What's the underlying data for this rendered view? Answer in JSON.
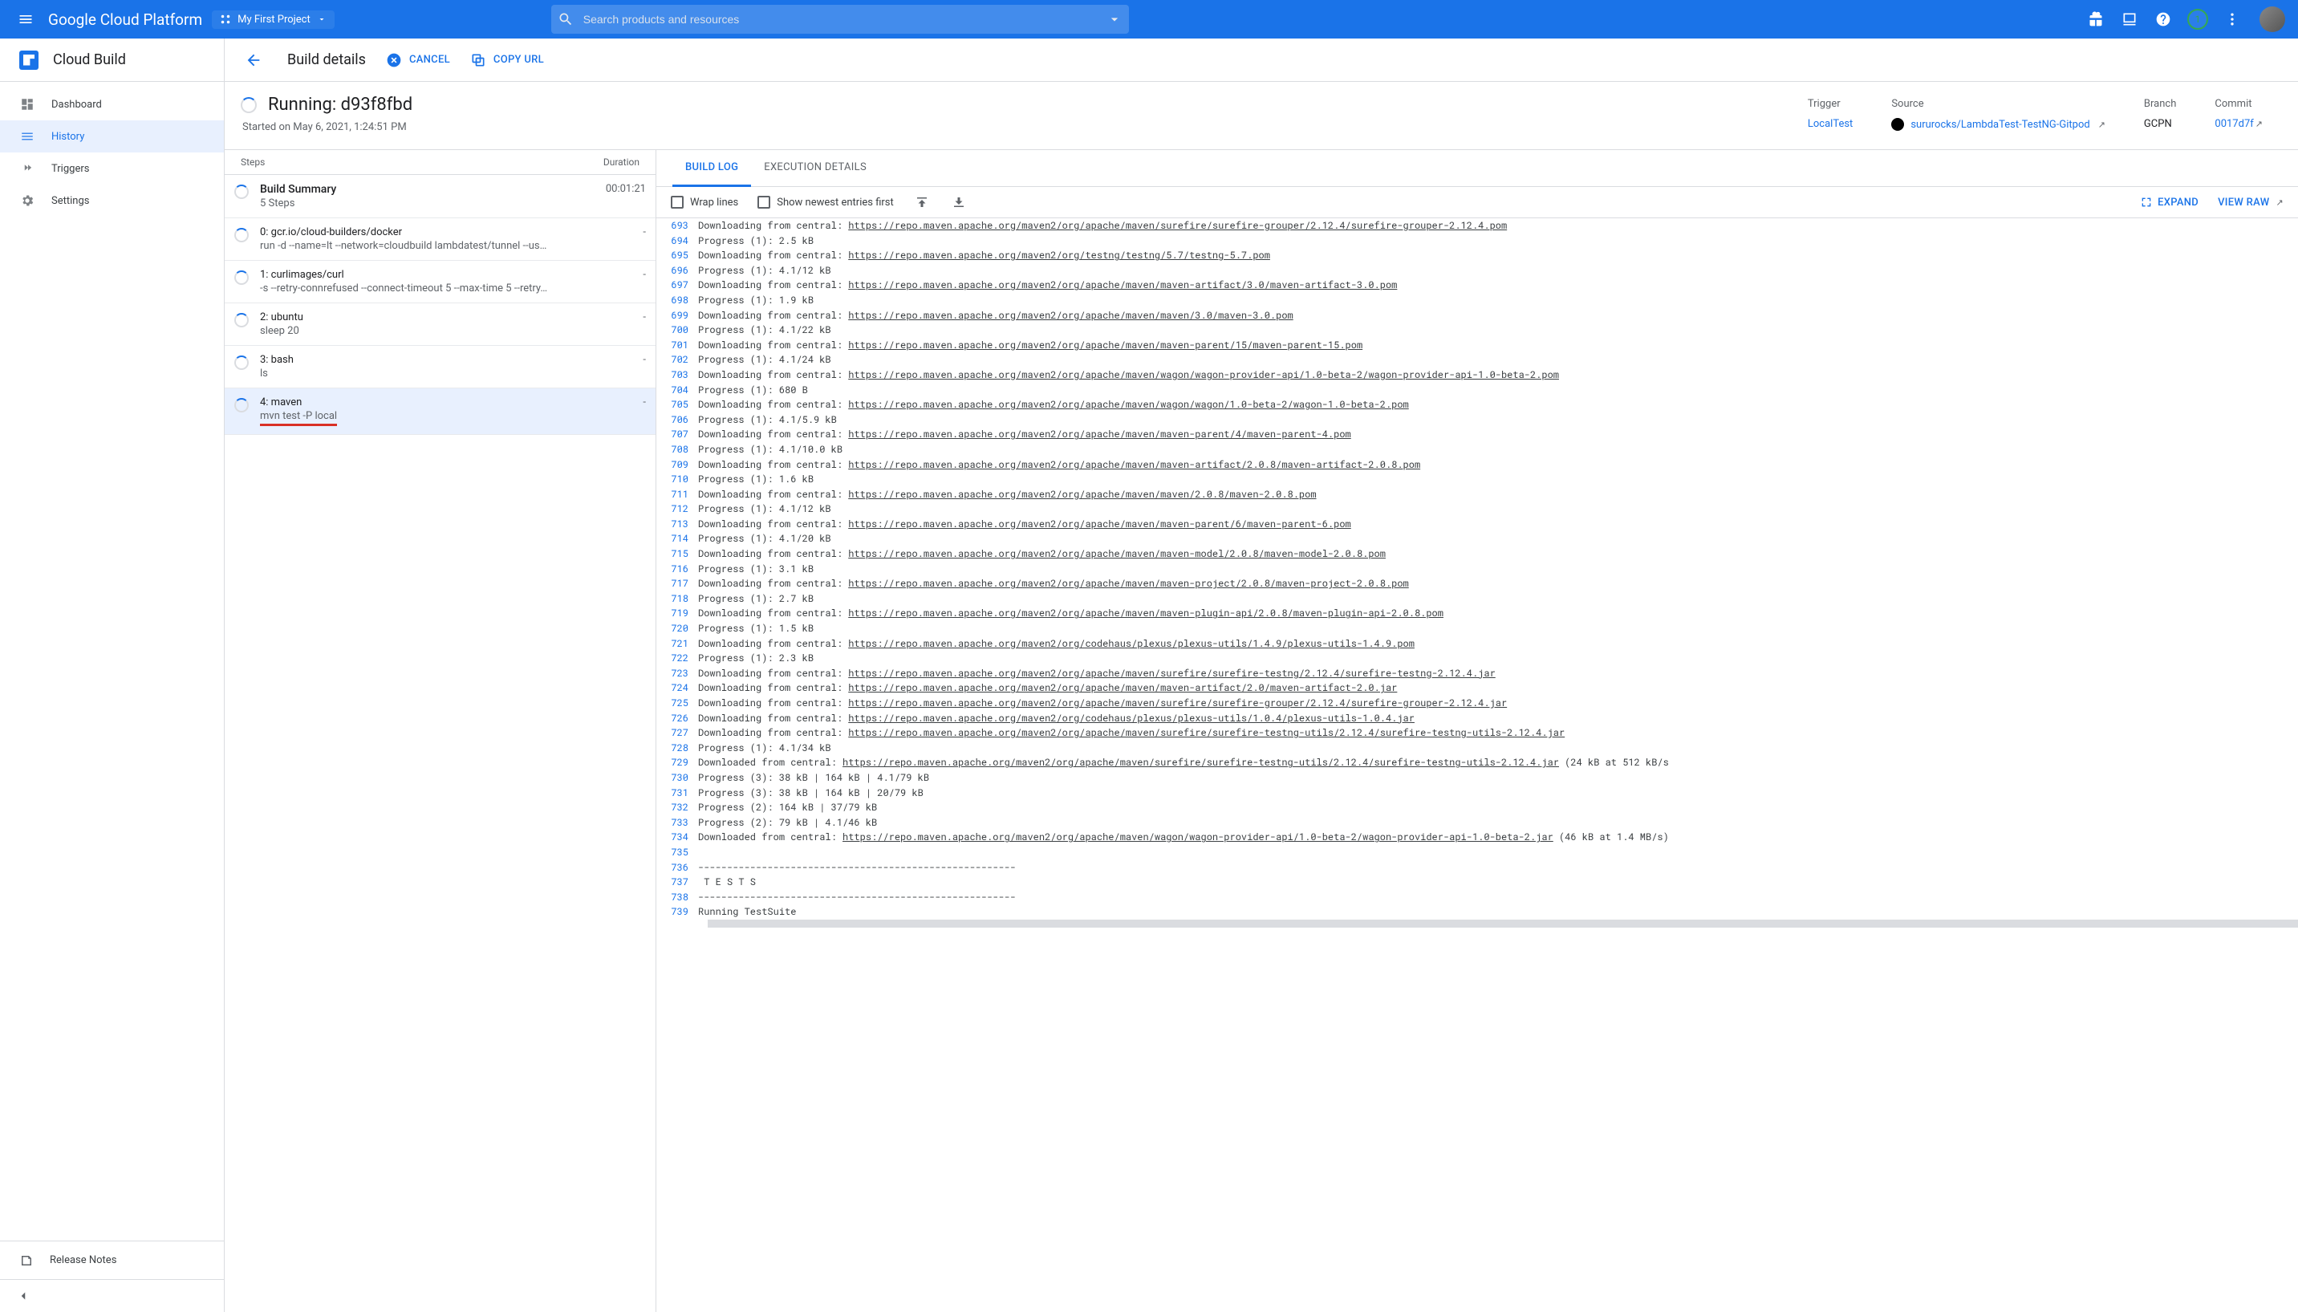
{
  "topbar": {
    "brand": "Google Cloud Platform",
    "project": "My First Project",
    "search_placeholder": "Search products and resources",
    "badge_count": "1"
  },
  "sidebar": {
    "product": "Cloud Build",
    "items": [
      {
        "icon": "dashboard",
        "label": "Dashboard"
      },
      {
        "icon": "history",
        "label": "History"
      },
      {
        "icon": "triggers",
        "label": "Triggers"
      },
      {
        "icon": "settings",
        "label": "Settings"
      }
    ],
    "release_notes": "Release Notes"
  },
  "toolbar": {
    "title": "Build details",
    "cancel": "CANCEL",
    "copy_url": "COPY URL"
  },
  "build": {
    "status_title": "Running: d93f8fbd",
    "started": "Started on May 6, 2021, 1:24:51 PM",
    "meta": {
      "trigger_lbl": "Trigger",
      "trigger_val": "LocalTest",
      "source_lbl": "Source",
      "source_val": "sururocks/LambdaTest-TestNG-Gitpod",
      "branch_lbl": "Branch",
      "branch_val": "GCPN",
      "commit_lbl": "Commit",
      "commit_val": "0017d7f"
    }
  },
  "steps": {
    "head_steps": "Steps",
    "head_duration": "Duration",
    "summary_title": "Build Summary",
    "summary_sub": "5 Steps",
    "summary_dur": "00:01:21",
    "list": [
      {
        "title": "0: gcr.io/cloud-builders/docker",
        "sub": "run -d --name=lt --network=cloudbuild lambdatest/tunnel --us…",
        "dur": "-"
      },
      {
        "title": "1: curlimages/curl",
        "sub": "-s --retry-connrefused --connect-timeout 5 --max-time 5 --retry…",
        "dur": "-"
      },
      {
        "title": "2: ubuntu",
        "sub": "sleep 20",
        "dur": "-"
      },
      {
        "title": "3: bash",
        "sub": "ls",
        "dur": "-"
      },
      {
        "title": "4: maven",
        "sub": "mvn test -P local",
        "dur": "-",
        "active": true,
        "redline": true
      }
    ]
  },
  "tabs": {
    "build_log": "BUILD LOG",
    "exec": "EXECUTION DETAILS"
  },
  "log_toolbar": {
    "wrap": "Wrap lines",
    "newest": "Show newest entries first",
    "expand": "EXPAND",
    "view_raw": "VIEW RAW"
  },
  "log_lines": [
    {
      "n": 693,
      "t": "Downloading from central: ",
      "u": "https://repo.maven.apache.org/maven2/org/apache/maven/surefire/surefire-grouper/2.12.4/surefire-grouper-2.12.4.pom"
    },
    {
      "n": 694,
      "t": "Progress (1): 2.5 kB"
    },
    {
      "n": 695,
      "t": "Downloading from central: ",
      "u": "https://repo.maven.apache.org/maven2/org/testng/testng/5.7/testng-5.7.pom"
    },
    {
      "n": 696,
      "t": "Progress (1): 4.1/12 kB"
    },
    {
      "n": 697,
      "t": "Downloading from central: ",
      "u": "https://repo.maven.apache.org/maven2/org/apache/maven/maven-artifact/3.0/maven-artifact-3.0.pom"
    },
    {
      "n": 698,
      "t": "Progress (1): 1.9 kB"
    },
    {
      "n": 699,
      "t": "Downloading from central: ",
      "u": "https://repo.maven.apache.org/maven2/org/apache/maven/maven/3.0/maven-3.0.pom"
    },
    {
      "n": 700,
      "t": "Progress (1): 4.1/22 kB"
    },
    {
      "n": 701,
      "t": "Downloading from central: ",
      "u": "https://repo.maven.apache.org/maven2/org/apache/maven/maven-parent/15/maven-parent-15.pom"
    },
    {
      "n": 702,
      "t": "Progress (1): 4.1/24 kB"
    },
    {
      "n": 703,
      "t": "Downloading from central: ",
      "u": "https://repo.maven.apache.org/maven2/org/apache/maven/wagon/wagon-provider-api/1.0-beta-2/wagon-provider-api-1.0-beta-2.pom"
    },
    {
      "n": 704,
      "t": "Progress (1): 680 B"
    },
    {
      "n": 705,
      "t": "Downloading from central: ",
      "u": "https://repo.maven.apache.org/maven2/org/apache/maven/wagon/wagon/1.0-beta-2/wagon-1.0-beta-2.pom"
    },
    {
      "n": 706,
      "t": "Progress (1): 4.1/5.9 kB"
    },
    {
      "n": 707,
      "t": "Downloading from central: ",
      "u": "https://repo.maven.apache.org/maven2/org/apache/maven/maven-parent/4/maven-parent-4.pom"
    },
    {
      "n": 708,
      "t": "Progress (1): 4.1/10.0 kB"
    },
    {
      "n": 709,
      "t": "Downloading from central: ",
      "u": "https://repo.maven.apache.org/maven2/org/apache/maven/maven-artifact/2.0.8/maven-artifact-2.0.8.pom"
    },
    {
      "n": 710,
      "t": "Progress (1): 1.6 kB"
    },
    {
      "n": 711,
      "t": "Downloading from central: ",
      "u": "https://repo.maven.apache.org/maven2/org/apache/maven/maven/2.0.8/maven-2.0.8.pom"
    },
    {
      "n": 712,
      "t": "Progress (1): 4.1/12 kB"
    },
    {
      "n": 713,
      "t": "Downloading from central: ",
      "u": "https://repo.maven.apache.org/maven2/org/apache/maven/maven-parent/6/maven-parent-6.pom"
    },
    {
      "n": 714,
      "t": "Progress (1): 4.1/20 kB"
    },
    {
      "n": 715,
      "t": "Downloading from central: ",
      "u": "https://repo.maven.apache.org/maven2/org/apache/maven/maven-model/2.0.8/maven-model-2.0.8.pom"
    },
    {
      "n": 716,
      "t": "Progress (1): 3.1 kB"
    },
    {
      "n": 717,
      "t": "Downloading from central: ",
      "u": "https://repo.maven.apache.org/maven2/org/apache/maven/maven-project/2.0.8/maven-project-2.0.8.pom"
    },
    {
      "n": 718,
      "t": "Progress (1): 2.7 kB"
    },
    {
      "n": 719,
      "t": "Downloading from central: ",
      "u": "https://repo.maven.apache.org/maven2/org/apache/maven/maven-plugin-api/2.0.8/maven-plugin-api-2.0.8.pom"
    },
    {
      "n": 720,
      "t": "Progress (1): 1.5 kB"
    },
    {
      "n": 721,
      "t": "Downloading from central: ",
      "u": "https://repo.maven.apache.org/maven2/org/codehaus/plexus/plexus-utils/1.4.9/plexus-utils-1.4.9.pom"
    },
    {
      "n": 722,
      "t": "Progress (1): 2.3 kB"
    },
    {
      "n": 723,
      "t": "Downloading from central: ",
      "u": "https://repo.maven.apache.org/maven2/org/apache/maven/surefire/surefire-testng/2.12.4/surefire-testng-2.12.4.jar"
    },
    {
      "n": 724,
      "t": "Downloading from central: ",
      "u": "https://repo.maven.apache.org/maven2/org/apache/maven/maven-artifact/2.0/maven-artifact-2.0.jar"
    },
    {
      "n": 725,
      "t": "Downloading from central: ",
      "u": "https://repo.maven.apache.org/maven2/org/apache/maven/surefire/surefire-grouper/2.12.4/surefire-grouper-2.12.4.jar"
    },
    {
      "n": 726,
      "t": "Downloading from central: ",
      "u": "https://repo.maven.apache.org/maven2/org/codehaus/plexus/plexus-utils/1.0.4/plexus-utils-1.0.4.jar"
    },
    {
      "n": 727,
      "t": "Downloading from central: ",
      "u": "https://repo.maven.apache.org/maven2/org/apache/maven/surefire/surefire-testng-utils/2.12.4/surefire-testng-utils-2.12.4.jar"
    },
    {
      "n": 728,
      "t": "Progress (1): 4.1/34 kB"
    },
    {
      "n": 729,
      "t": "Downloaded from central: ",
      "u": "https://repo.maven.apache.org/maven2/org/apache/maven/surefire/surefire-testng-utils/2.12.4/surefire-testng-utils-2.12.4.jar",
      "a": " (24 kB at 512 kB/s"
    },
    {
      "n": 730,
      "t": "Progress (3): 38 kB | 164 kB | 4.1/79 kB"
    },
    {
      "n": 731,
      "t": "Progress (3): 38 kB | 164 kB | 20/79 kB"
    },
    {
      "n": 732,
      "t": "Progress (2): 164 kB | 37/79 kB"
    },
    {
      "n": 733,
      "t": "Progress (2): 79 kB | 4.1/46 kB"
    },
    {
      "n": 734,
      "t": "Downloaded from central: ",
      "u": "https://repo.maven.apache.org/maven2/org/apache/maven/wagon/wagon-provider-api/1.0-beta-2/wagon-provider-api-1.0-beta-2.jar",
      "a": " (46 kB at 1.4 MB/s)"
    },
    {
      "n": 735,
      "t": ""
    },
    {
      "n": 736,
      "t": "-------------------------------------------------------"
    },
    {
      "n": 737,
      "t": " T E S T S"
    },
    {
      "n": 738,
      "t": "-------------------------------------------------------"
    },
    {
      "n": 739,
      "t": "Running TestSuite"
    }
  ]
}
